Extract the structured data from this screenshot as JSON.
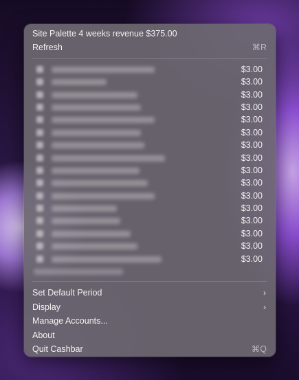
{
  "menu": {
    "header_title": "Site Palette 4 weeks revenue $375.00",
    "refresh_label": "Refresh",
    "refresh_shortcut": "⌘R",
    "transactions": [
      {
        "amount": "$3.00"
      },
      {
        "amount": "$3.00"
      },
      {
        "amount": "$3.00"
      },
      {
        "amount": "$3.00"
      },
      {
        "amount": "$3.00"
      },
      {
        "amount": "$3.00"
      },
      {
        "amount": "$3.00"
      },
      {
        "amount": "$3.00"
      },
      {
        "amount": "$3.00"
      },
      {
        "amount": "$3.00"
      },
      {
        "amount": "$3.00"
      },
      {
        "amount": "$3.00"
      },
      {
        "amount": "$3.00"
      },
      {
        "amount": "$3.00"
      },
      {
        "amount": "$3.00"
      },
      {
        "amount": "$3.00"
      }
    ],
    "set_default_period_label": "Set Default Period",
    "display_label": "Display",
    "manage_accounts_label": "Manage Accounts...",
    "about_label": "About",
    "quit_label": "Quit Cashbar",
    "quit_shortcut": "⌘Q",
    "submenu_chevron": "›"
  }
}
